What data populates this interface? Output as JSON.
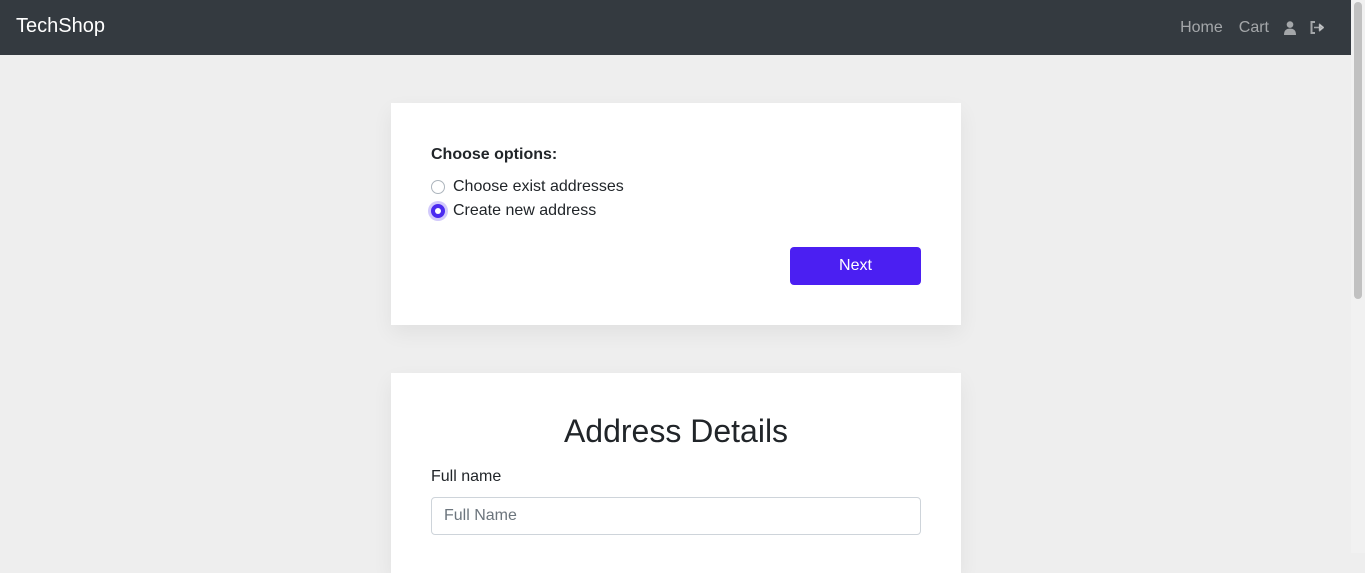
{
  "navbar": {
    "brand": "TechShop",
    "links": [
      "Home",
      "Cart"
    ],
    "icons": [
      "user-icon",
      "sign-out-icon"
    ]
  },
  "options": {
    "title": "Choose options:",
    "items": [
      "Choose exist addresses",
      "Create new address"
    ],
    "selected": "Create new address",
    "next_label": "Next"
  },
  "address": {
    "title": "Address Details",
    "full_name_label": "Full name",
    "full_name_placeholder": "Full Name",
    "full_name_value": ""
  },
  "colors": {
    "navbar": "#343a40",
    "accent": "#4b1ff2",
    "background": "#eeeeee"
  }
}
